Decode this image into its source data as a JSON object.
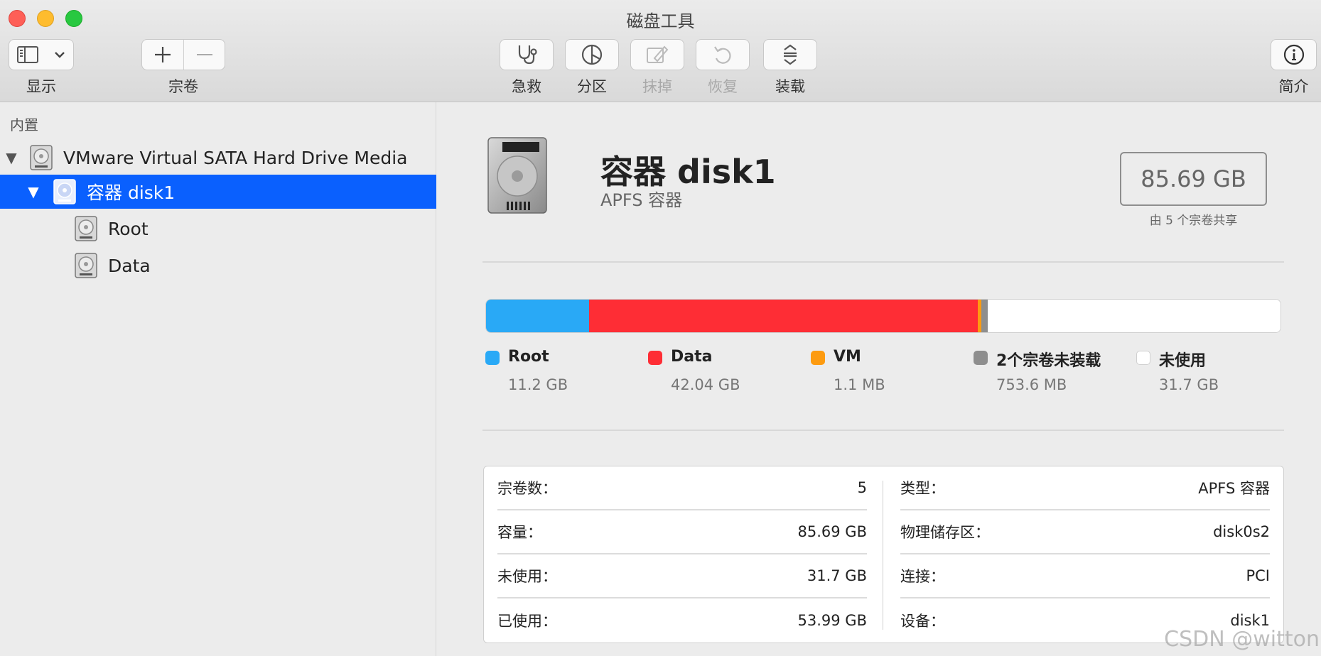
{
  "window": {
    "title": "磁盘工具"
  },
  "toolbar": {
    "view_label": "显示",
    "volume_label": "宗卷",
    "firstaid_label": "急救",
    "partition_label": "分区",
    "erase_label": "抹掉",
    "restore_label": "恢复",
    "mount_label": "装载",
    "info_label": "简介"
  },
  "sidebar": {
    "section": "内置",
    "items": [
      {
        "label": "VMware Virtual SATA Hard Drive Media"
      },
      {
        "label": "容器 disk1"
      },
      {
        "label": "Root"
      },
      {
        "label": "Data"
      }
    ]
  },
  "detail": {
    "title": "容器 disk1",
    "subtitle": "APFS 容器",
    "capacity": "85.69 GB",
    "shared_note": "由 5 个宗卷共享"
  },
  "usage": {
    "segments": [
      {
        "name": "Root",
        "size": "11.2 GB",
        "gb": 11.2,
        "color": "#29a9f6"
      },
      {
        "name": "Data",
        "size": "42.04 GB",
        "gb": 42.04,
        "color": "#fe2d35"
      },
      {
        "name": "VM",
        "size": "1.1 MB",
        "gb": 0.0011,
        "color": "#fd9b10"
      },
      {
        "name": "2个宗卷未装载",
        "size": "753.6 MB",
        "gb": 0.7536,
        "color": "#8e8e8e"
      },
      {
        "name": "未使用",
        "size": "31.7 GB",
        "gb": 31.7,
        "color": "#ffffff"
      }
    ]
  },
  "info": {
    "left": [
      {
        "label": "宗卷数：",
        "value": "5"
      },
      {
        "label": "容量：",
        "value": "85.69 GB"
      },
      {
        "label": "未使用：",
        "value": "31.7 GB"
      },
      {
        "label": "已使用：",
        "value": "53.99 GB"
      }
    ],
    "right": [
      {
        "label": "类型：",
        "value": "APFS 容器"
      },
      {
        "label": "物理储存区：",
        "value": "disk0s2"
      },
      {
        "label": "连接：",
        "value": "PCI"
      },
      {
        "label": "设备：",
        "value": "disk1"
      }
    ]
  },
  "watermark": "CSDN @witton"
}
